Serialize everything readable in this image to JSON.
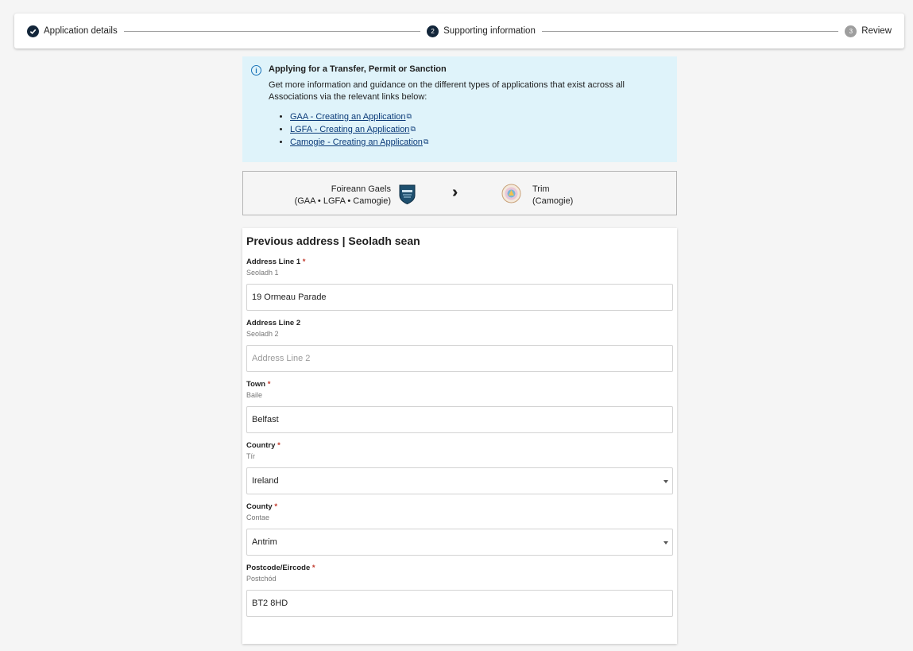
{
  "stepper": {
    "steps": [
      {
        "number": "✓",
        "label": "Application details",
        "state": "done"
      },
      {
        "number": "2",
        "label": "Supporting information",
        "state": "active"
      },
      {
        "number": "3",
        "label": "Review",
        "state": "pending"
      }
    ]
  },
  "info": {
    "icon": "info-icon",
    "title": "Applying for a Transfer, Permit or Sanction",
    "body": "Get more information and guidance on the different types of applications that exist across all Associations via the relevant links below:",
    "links": [
      "GAA - Creating an Application",
      "LGFA - Creating an Application",
      "Camogie - Creating an Application"
    ]
  },
  "transfer": {
    "from_name": "Foireann Gaels",
    "from_assoc": "(GAA • LGFA • Camogie)",
    "to_name": "Trim",
    "to_assoc": "(Camogie)"
  },
  "form": {
    "title": "Previous address | Seoladh sean",
    "fields": [
      {
        "label": "Address Line 1",
        "required": "*",
        "sublabel": "Seoladh 1",
        "value": "19 Ormeau Parade"
      },
      {
        "label": "Address Line 2",
        "required": "",
        "sublabel": "Seoladh 2",
        "placeholder": "Address Line 2"
      },
      {
        "label": "Town",
        "required": "*",
        "sublabel": "Baile",
        "value": "Belfast"
      },
      {
        "label": "Country",
        "required": "*",
        "sublabel": "Tír",
        "value": "Ireland"
      },
      {
        "label": "County",
        "required": "*",
        "sublabel": "Contae",
        "value": "Antrim"
      },
      {
        "label": "Postcode/Eircode",
        "required": "*",
        "sublabel": "Postchód",
        "value": "BT2 8HD"
      }
    ]
  },
  "colors": {
    "accent": "#13263a",
    "info_bg": "#dff3fa",
    "link": "#0a3a78",
    "required": "#c0392b"
  }
}
